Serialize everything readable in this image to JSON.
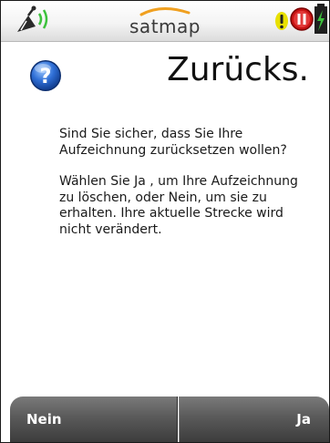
{
  "status_bar": {
    "brand_name": "satmap",
    "brand_color": "#f0a020",
    "left_icon": "gps-signal-icon",
    "right_icons": [
      "warning-icon",
      "pause-record-icon",
      "battery-icon"
    ]
  },
  "dialog": {
    "title": "Zurücks.",
    "icon": "help-question-icon",
    "paragraph_1": "Sind Sie sicher, dass Sie Ihre Aufzeichnung zurücksetzen wollen?",
    "paragraph_2": "Wählen Sie Ja , um Ihre Aufzeichnung zu löschen, oder Nein, um sie zu erhalten. Ihre aktuelle Strecke wird nicht verändert."
  },
  "buttons": {
    "no_label": "Nein",
    "yes_label": "Ja"
  }
}
